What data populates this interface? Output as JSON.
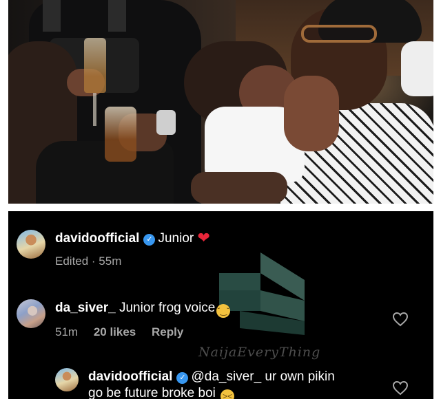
{
  "photo": {
    "description_icon": "photo"
  },
  "comments": [
    {
      "username": "davidoofficial",
      "verified": true,
      "text": "Junior",
      "emoji": "❤",
      "meta_edited": "Edited · 55m"
    },
    {
      "username": "da_siver_",
      "verified": false,
      "text": "Junior frog voice",
      "emoji": "😏",
      "meta_time": "51m",
      "meta_likes": "20 likes",
      "meta_reply": "Reply"
    },
    {
      "username": "davidoofficial",
      "verified": true,
      "text_line1": "@da_siver_ ur own pikin",
      "text_line2": "go be future broke boi",
      "emoji": "😫"
    }
  ],
  "watermark": {
    "text": "NaijaEveryThing"
  },
  "colors": {
    "panel_bg": "#000000",
    "verified_blue": "#3897f0",
    "heart_red": "#e8263a",
    "meta_gray": "#a8a8a8"
  }
}
